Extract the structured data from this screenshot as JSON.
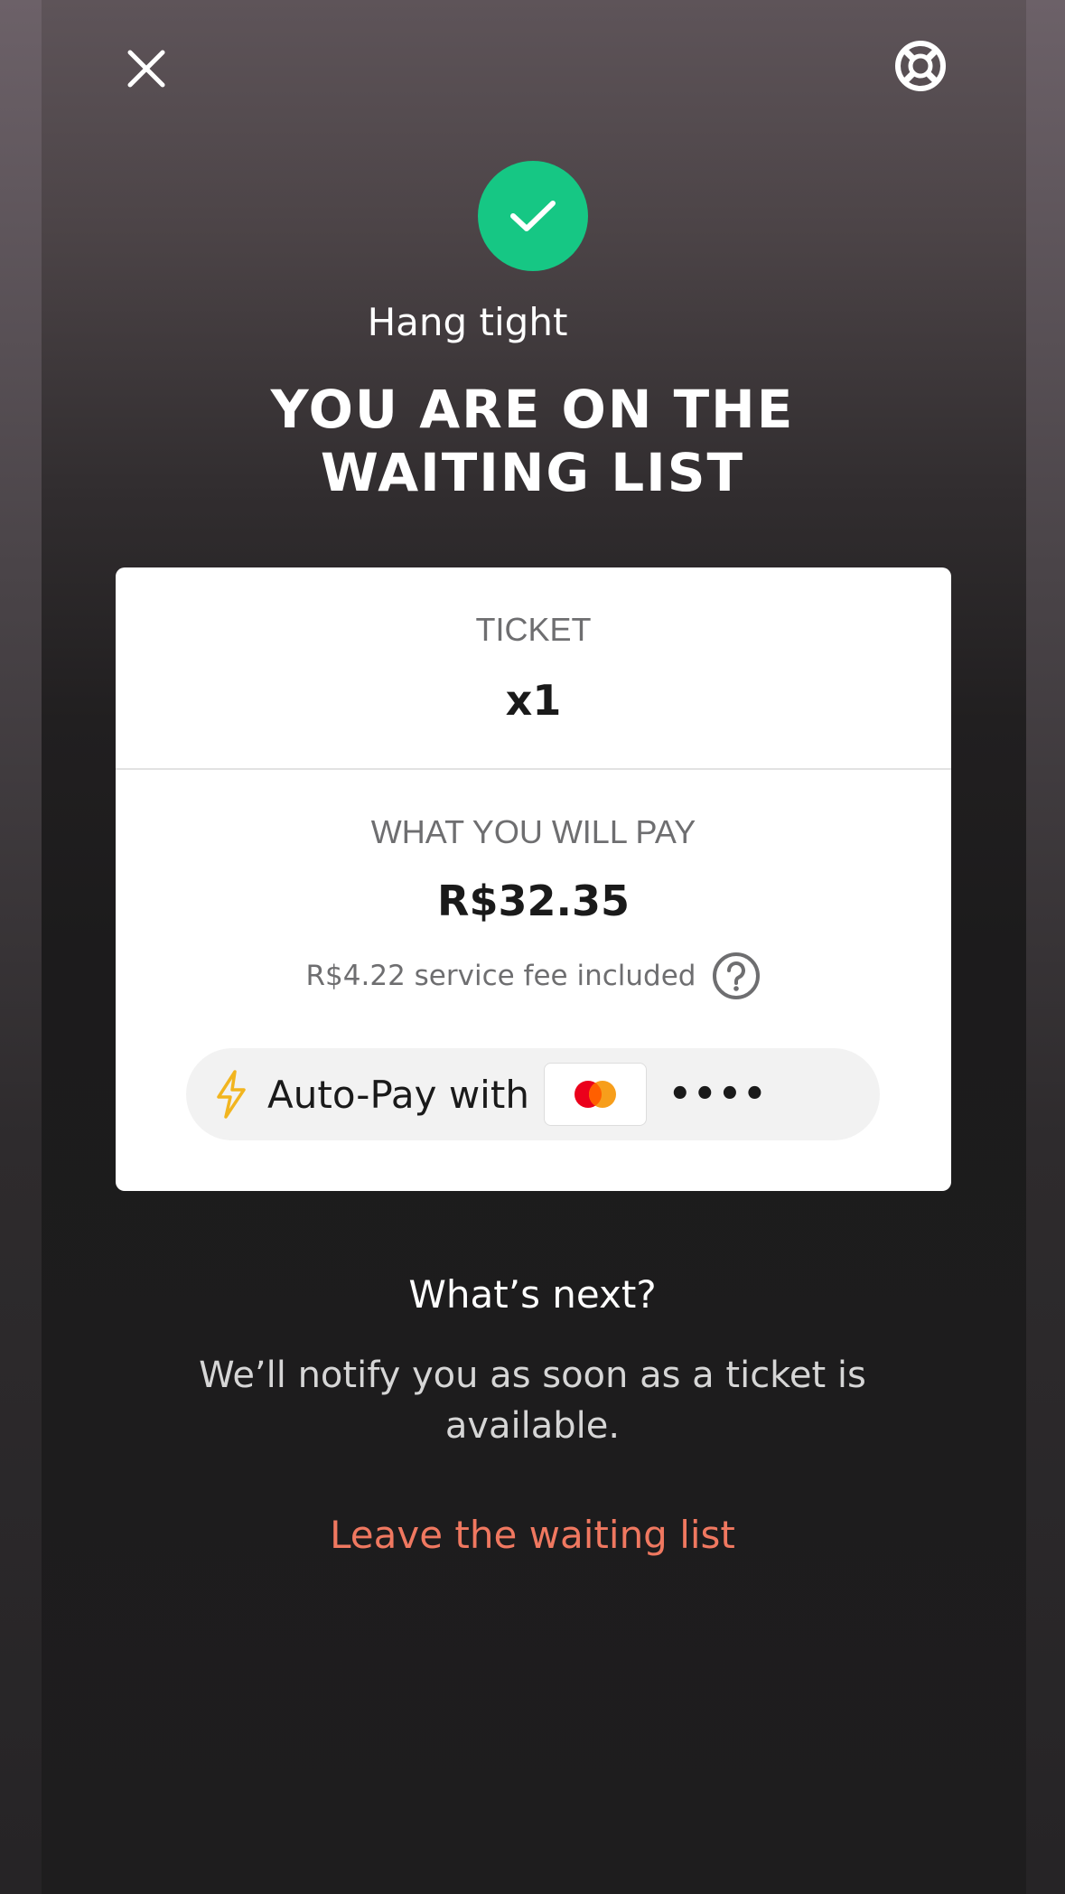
{
  "header": {
    "close_icon": "close-icon",
    "help_icon": "lifebuoy-icon"
  },
  "status": {
    "icon": "check-icon",
    "color": "#16c784",
    "subtitle": "Hang tight",
    "headline_line1": "YOU ARE ON THE",
    "headline_line2": "WAITING LIST"
  },
  "summary": {
    "ticket_label": "TICKET",
    "ticket_quantity": "x1",
    "pay_label": "WHAT YOU WILL PAY",
    "price": "R$32.35",
    "fee_text": "R$4.22 service fee included",
    "fee_help_icon": "question-circle-icon",
    "autopay": {
      "icon": "lightning-icon",
      "label": "Auto-Pay with",
      "card_brand": "mastercard",
      "card_masked": "••••"
    }
  },
  "next": {
    "title": "What’s next?",
    "body": "We’ll notify you as soon as a ticket is available."
  },
  "actions": {
    "leave_label": "Leave the waiting list",
    "leave_color": "#f07860"
  }
}
